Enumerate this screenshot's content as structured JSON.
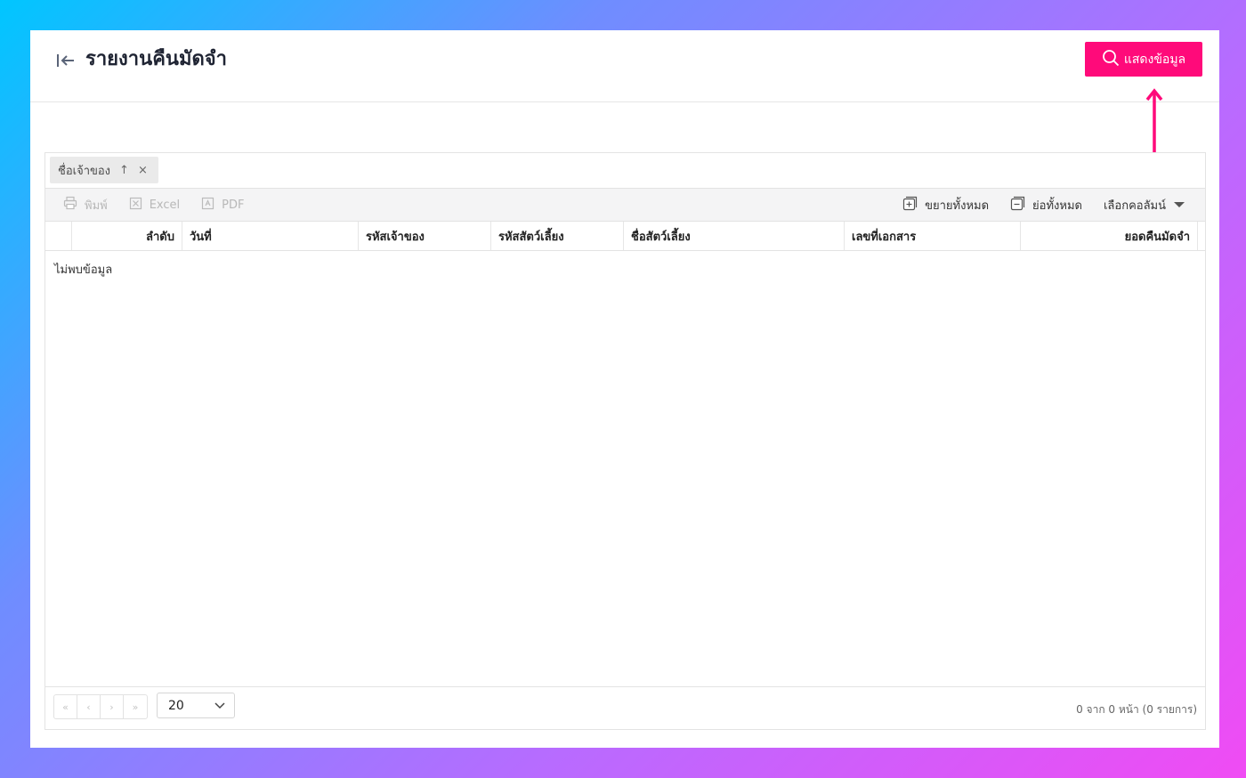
{
  "header": {
    "title": "รายงานคืนมัดจำ",
    "show_button": "แสดงข้อมูล",
    "accent_color": "#ff0a7a"
  },
  "group_panel": {
    "chip_label": "ชื่อเจ้าของ",
    "sort_glyph": "↑",
    "remove_glyph": "×"
  },
  "toolbar": {
    "print": "พิมพ์",
    "excel": "Excel",
    "pdf": "PDF",
    "expand_all": "ขยายทั้งหมด",
    "collapse_all": "ย่อทั้งหมด",
    "choose_columns": "เลือกคอลัมน์"
  },
  "table": {
    "columns": [
      "ลำดับ",
      "วันที่",
      "รหัสเจ้าของ",
      "รหัสสัตว์เลี้ยง",
      "ชื่อสัตว์เลี้ยง",
      "เลขที่เอกสาร",
      "ยอดคืนมัดจำ"
    ],
    "empty_message": "ไม่พบข้อมูล"
  },
  "pager": {
    "first": "«",
    "prev": "‹",
    "next": "›",
    "last": "»",
    "page_size": "20",
    "info": "0 จาก 0 หน้า (0 รายการ)"
  }
}
